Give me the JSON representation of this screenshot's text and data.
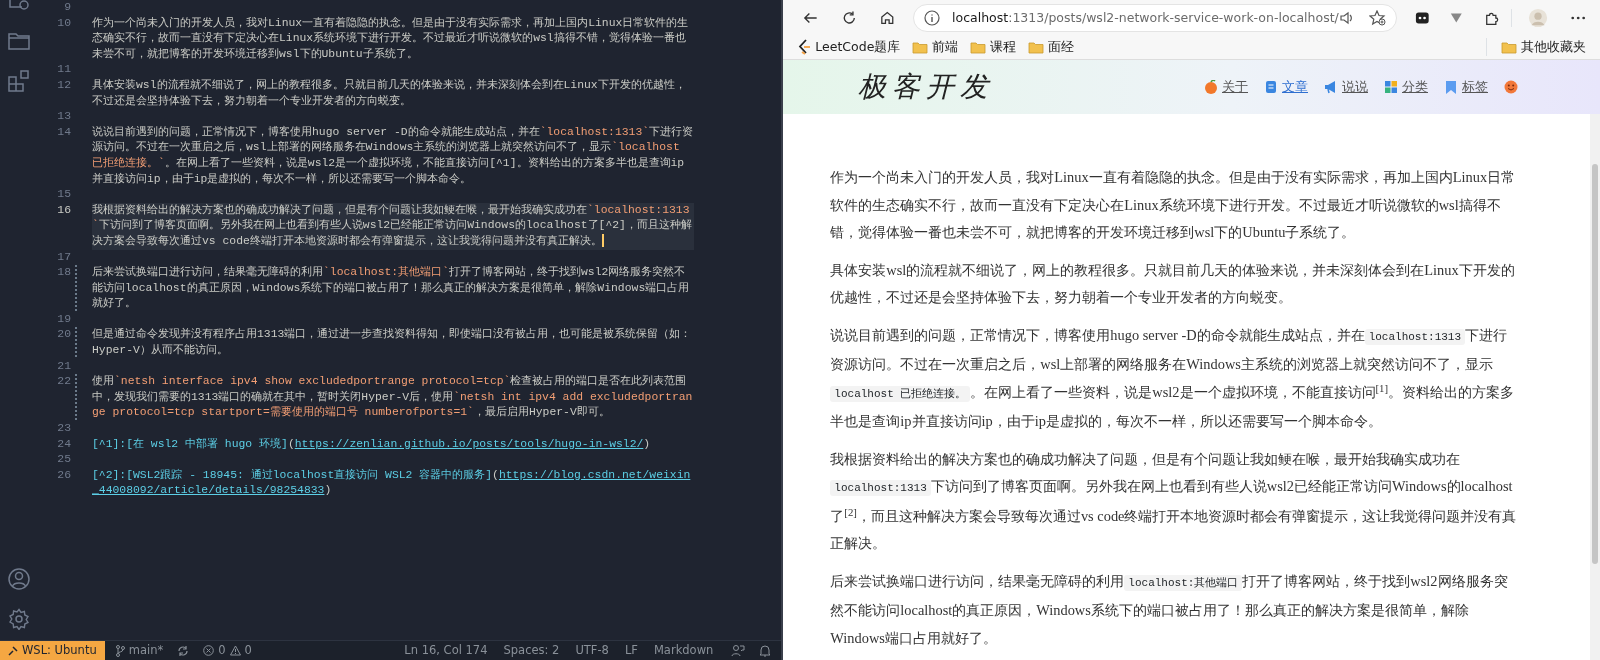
{
  "editor": {
    "lines": [
      {
        "number": "9",
        "modified": false,
        "current": false
      },
      {
        "number": "10",
        "modified": false,
        "current": false,
        "segments": [
          {
            "kind": "text",
            "text": "作为一个尚未入门的开发人员，我对Linux一直有着隐隐的执念。但是由于没有实际需求，再加上国内Linux日常软件的生态确实不行，故而一直没有下定决心在Linux系统环境下进行开发。不过最近才听说微软的wsl搞得不错，觉得体验一番也未尝不可，就把博客的开发环境迁移到wsl下的Ubuntu子系统了。"
          }
        ]
      },
      {
        "number": "11",
        "modified": false,
        "current": false
      },
      {
        "number": "12",
        "modified": false,
        "current": false,
        "segments": [
          {
            "kind": "text",
            "text": "具体安装wsl的流程就不细说了，网上的教程很多。只就目前几天的体验来说，并未深刻体会到在Linux下开发的优越性，不过还是会坚持体验下去，努力朝着一个专业开发者的方向蜕变。"
          }
        ]
      },
      {
        "number": "13",
        "modified": false,
        "current": false
      },
      {
        "number": "14",
        "modified": false,
        "current": false,
        "segments": [
          {
            "kind": "text",
            "text": "说说目前遇到的问题，正常情况下，博客使用hugo server -D的命令就能生成站点，并在"
          },
          {
            "kind": "code",
            "text": "`localhost:1313`"
          },
          {
            "kind": "text",
            "text": "下进行资源访问。不过在一次重启之后，wsl上部署的网络服务在Windows主系统的浏览器上就突然访问不了，显示"
          },
          {
            "kind": "code",
            "text": "`localhost 已拒绝连接。`"
          },
          {
            "kind": "text",
            "text": "。在网上看了一些资料，说是wsl2是一个虚拟环境，不能直接访问[^1]。资料给出的方案多半也是查询ip并直接访问ip，由于ip是虚拟的，每次不一样，所以还需要写一个脚本命令。"
          }
        ]
      },
      {
        "number": "15",
        "modified": false,
        "current": false
      },
      {
        "number": "16",
        "modified": false,
        "current": true,
        "segments": [
          {
            "kind": "text",
            "text": "我根据资料给出的解决方案也的确成功解决了问题，但是有个问题让我如鲠在喉，最开始我确实成功在"
          },
          {
            "kind": "code",
            "text": "`localhost:1313`"
          },
          {
            "kind": "text",
            "text": "下访问到了博客页面啊。另外我在网上也看到有些人说wsl2已经能正常访问Windows的localhost了[^2]，而且这种解决方案会导致每次通过vs code终端打开本地资源时都会有弹窗提示，这让我觉得问题并没有真正解决。"
          }
        ]
      },
      {
        "number": "17",
        "modified": false,
        "current": false
      },
      {
        "number": "18",
        "modified": true,
        "current": false,
        "segments": [
          {
            "kind": "text",
            "text": "后来尝试换端口进行访问，结果毫无障碍的利用"
          },
          {
            "kind": "code",
            "text": "`localhost:其他端口`"
          },
          {
            "kind": "text",
            "text": "打开了博客网站，终于找到wsl2网络服务突然不能访问localhost的真正原因，Windows系统下的端口被占用了！那么真正的解决方案是很简单，解除Windows端口占用就好了。"
          }
        ]
      },
      {
        "number": "19",
        "modified": false,
        "current": false
      },
      {
        "number": "20",
        "modified": true,
        "current": false,
        "segments": [
          {
            "kind": "text",
            "text": "但是通过命令发现并没有程序占用1313端口，通过进一步查找资料得知，即使端口没有被占用，也可能是被系统保留（如：Hyper-V）从而不能访问。"
          }
        ]
      },
      {
        "number": "21",
        "modified": false,
        "current": false
      },
      {
        "number": "22",
        "modified": true,
        "current": false,
        "segments": [
          {
            "kind": "text",
            "text": "使用"
          },
          {
            "kind": "code",
            "text": "`netsh interface ipv4 show excludedportrange protocol=tcp`"
          },
          {
            "kind": "text",
            "text": "检查被占用的端口是否在此列表范围中，发现我们需要的1313端口的确就在其中，暂时关闭Hyper-V后，使用"
          },
          {
            "kind": "code",
            "text": "`netsh int ipv4 add excludedportrange protocol=tcp startport=需要使用的端口号 numberofports=1`"
          },
          {
            "kind": "text",
            "text": "，最后启用Hyper-V即可。"
          }
        ]
      },
      {
        "number": "23",
        "modified": false,
        "current": false
      },
      {
        "number": "24",
        "modified": false,
        "current": false,
        "segments": [
          {
            "kind": "link_text",
            "text": "[^1]:[在 wsl2 中部署 hugo 环境]"
          },
          {
            "kind": "text",
            "text": "("
          },
          {
            "kind": "url",
            "text": "https://zenlian.github.io/posts/tools/hugo-in-wsl2/"
          },
          {
            "kind": "text",
            "text": ")"
          }
        ]
      },
      {
        "number": "25",
        "modified": false,
        "current": false
      },
      {
        "number": "26",
        "modified": false,
        "current": false,
        "segments": [
          {
            "kind": "link_text",
            "text": "[^2]:[WSL2跟踪 - 18945: 通过localhost直接访问 WSL2 容器中的服务]"
          },
          {
            "kind": "text",
            "text": "("
          },
          {
            "kind": "url",
            "text": "https://blog.csdn.net/weixin_44008092/article/details/98254833"
          },
          {
            "kind": "text",
            "text": ")"
          }
        ]
      }
    ]
  },
  "status_bar": {
    "remote": "WSL: Ubuntu",
    "branch": "main*",
    "errors": "0",
    "warnings": "0",
    "items": [
      "Ln 16, Col 174",
      "Spaces: 2",
      "UTF-8",
      "LF",
      "Markdown"
    ]
  },
  "browser": {
    "address": {
      "host": "localhost",
      "path": ":1313/posts/wsl2-network-service-work-on-localhost/"
    },
    "bookmarks": [
      {
        "label": "LeetCode题库",
        "kind": "site"
      },
      {
        "label": "前端",
        "kind": "folder"
      },
      {
        "label": "课程",
        "kind": "folder"
      },
      {
        "label": "面经",
        "kind": "folder"
      }
    ],
    "other_bookmarks": "其他收藏夹"
  },
  "site": {
    "logo": "极客开发",
    "nav": [
      {
        "label": "关于",
        "selected": false
      },
      {
        "label": "文章",
        "selected": true
      },
      {
        "label": "说说",
        "selected": false
      },
      {
        "label": "分类",
        "selected": false
      },
      {
        "label": "标签",
        "selected": false
      }
    ]
  },
  "article": {
    "paragraphs": [
      {
        "segments": [
          {
            "kind": "text",
            "text": "作为一个尚未入门的开发人员，我对Linux一直有着隐隐的执念。但是由于没有实际需求，再加上国内Linux日常软件的生态确实不行，故而一直没有下定决心在Linux系统环境下进行开发。不过最近才听说微软的wsl搞得不错，觉得体验一番也未尝不可，就把博客的开发环境迁移到wsl下的Ubuntu子系统了。"
          }
        ]
      },
      {
        "segments": [
          {
            "kind": "text",
            "text": "具体安装wsl的流程就不细说了，网上的教程很多。只就目前几天的体验来说，并未深刻体会到在Linux下开发的优越性，不过还是会坚持体验下去，努力朝着一个专业开发者的方向蜕变。"
          }
        ]
      },
      {
        "segments": [
          {
            "kind": "text",
            "text": "说说目前遇到的问题，正常情况下，博客使用hugo server -D的命令就能生成站点，并在"
          },
          {
            "kind": "code",
            "text": "localhost:1313"
          },
          {
            "kind": "text",
            "text": "下进行资源访问。不过在一次重启之后，wsl上部署的网络服务在Windows主系统的浏览器上就突然访问不了，显示"
          },
          {
            "kind": "code",
            "text": "localhost 已拒绝连接。"
          },
          {
            "kind": "text",
            "text": "。在网上看了一些资料，说是wsl2是一个虚拟环境，不能直接访问"
          },
          {
            "kind": "sup",
            "text": "[1]"
          },
          {
            "kind": "text",
            "text": "。资料给出的方案多半也是查询ip并直接访问ip，由于ip是虚拟的，每次不一样，所以还需要写一个脚本命令。"
          }
        ]
      },
      {
        "segments": [
          {
            "kind": "text",
            "text": "我根据资料给出的解决方案也的确成功解决了问题，但是有个问题让我如鲠在喉，最开始我确实成功在"
          },
          {
            "kind": "code",
            "text": "localhost:1313"
          },
          {
            "kind": "text",
            "text": "下访问到了博客页面啊。另外我在网上也看到有些人说wsl2已经能正常访问Windows的localhost了"
          },
          {
            "kind": "sup",
            "text": "[2]"
          },
          {
            "kind": "text",
            "text": "，而且这种解决方案会导致每次通过vs code终端打开本地资源时都会有弹窗提示，这让我觉得问题并没有真正解决。"
          }
        ]
      },
      {
        "segments": [
          {
            "kind": "text",
            "text": "后来尝试换端口进行访问，结果毫无障碍的利用"
          },
          {
            "kind": "code",
            "text": "localhost:其他端口"
          },
          {
            "kind": "text",
            "text": "打开了博客网站，终于找到wsl2网络服务突然不能访问localhost的真正原因，Windows系统下的端口被占用了！那么真正的解决方案是很简单，解除Windows端口占用就好了。"
          }
        ]
      }
    ]
  }
}
